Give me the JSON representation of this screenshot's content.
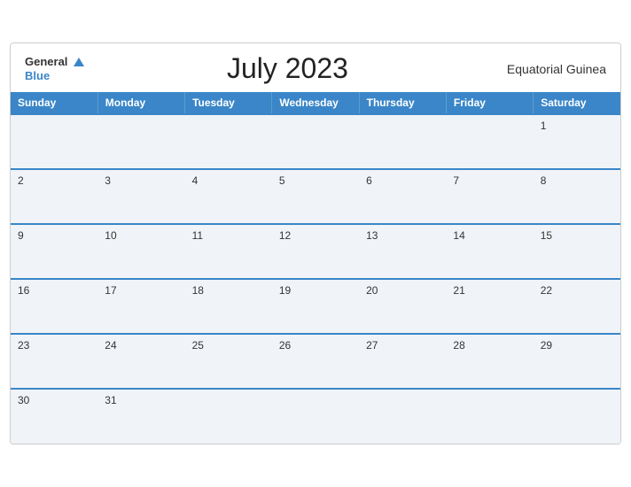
{
  "header": {
    "logo_general": "General",
    "logo_blue": "Blue",
    "month_title": "July 2023",
    "country": "Equatorial Guinea"
  },
  "weekdays": [
    "Sunday",
    "Monday",
    "Tuesday",
    "Wednesday",
    "Thursday",
    "Friday",
    "Saturday"
  ],
  "weeks": [
    [
      "",
      "",
      "",
      "",
      "",
      "",
      "1"
    ],
    [
      "2",
      "3",
      "4",
      "5",
      "6",
      "7",
      "8"
    ],
    [
      "9",
      "10",
      "11",
      "12",
      "13",
      "14",
      "15"
    ],
    [
      "16",
      "17",
      "18",
      "19",
      "20",
      "21",
      "22"
    ],
    [
      "23",
      "24",
      "25",
      "26",
      "27",
      "28",
      "29"
    ],
    [
      "30",
      "31",
      "",
      "",
      "",
      "",
      ""
    ]
  ]
}
